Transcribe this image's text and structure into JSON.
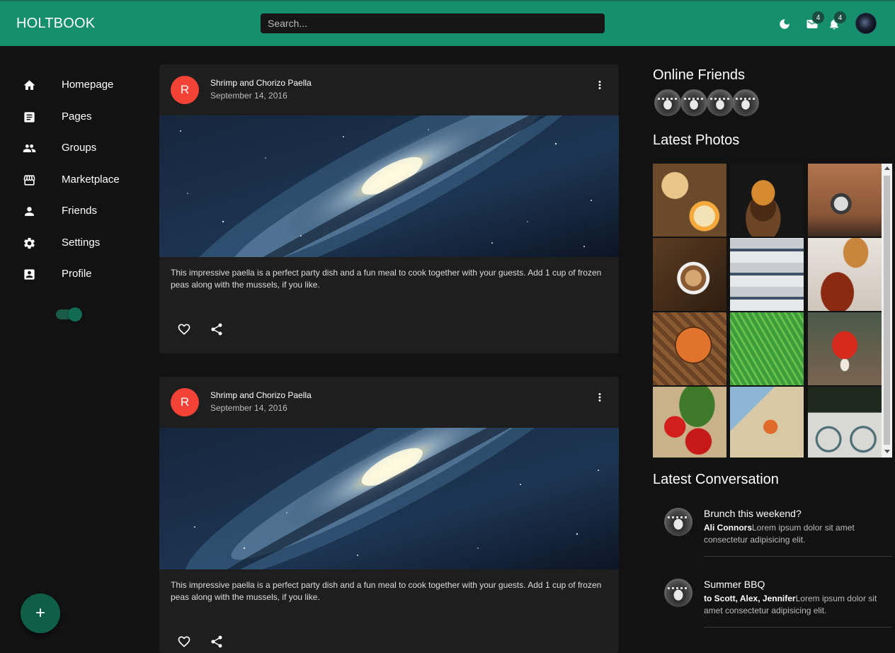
{
  "header": {
    "brand": "HOLTBOOK",
    "search_placeholder": "Search...",
    "mail_badge": "4",
    "notif_badge": "4",
    "icons": [
      "moon-icon",
      "mail-icon",
      "bell-icon",
      "user-avatar"
    ]
  },
  "sidebar": {
    "items": [
      {
        "label": "Homepage",
        "icon": "home-icon"
      },
      {
        "label": "Pages",
        "icon": "article-icon"
      },
      {
        "label": "Groups",
        "icon": "groups-icon"
      },
      {
        "label": "Marketplace",
        "icon": "storefront-icon"
      },
      {
        "label": "Friends",
        "icon": "person-icon"
      },
      {
        "label": "Settings",
        "icon": "gear-icon"
      },
      {
        "label": "Profile",
        "icon": "account-box-icon"
      }
    ],
    "dark_mode_on": true,
    "fab_label": "+"
  },
  "posts": [
    {
      "avatar_letter": "R",
      "title": "Shrimp and Chorizo Paella",
      "date": "September 14, 2016",
      "body": "This impressive paella is a perfect party dish and a fun meal to cook together with your guests. Add 1 cup of frozen peas along with the mussels, if you like."
    },
    {
      "avatar_letter": "R",
      "title": "Shrimp and Chorizo Paella",
      "date": "September 14, 2016",
      "body": "This impressive paella is a perfect party dish and a fun meal to cook together with your guests. Add 1 cup of frozen peas along with the mussels, if you like."
    }
  ],
  "right": {
    "online_friends_title": "Online Friends",
    "latest_photos_title": "Latest Photos",
    "latest_conversation_title": "Latest Conversation",
    "conversations": [
      {
        "title": "Brunch this weekend?",
        "from": "Ali Connors",
        "text": "Lorem ipsum dolor sit amet consectetur adipisicing elit."
      },
      {
        "title": "Summer BBQ",
        "from": "to Scott, Alex, Jennifer",
        "text": "Lorem ipsum dolor sit amet consectetur adipisicing elit."
      }
    ]
  },
  "colors": {
    "topbar": "#168f6c",
    "background": "#121212",
    "card": "#1e1e1e",
    "post_avatar": "#f44336",
    "fab": "#0f5e47"
  }
}
